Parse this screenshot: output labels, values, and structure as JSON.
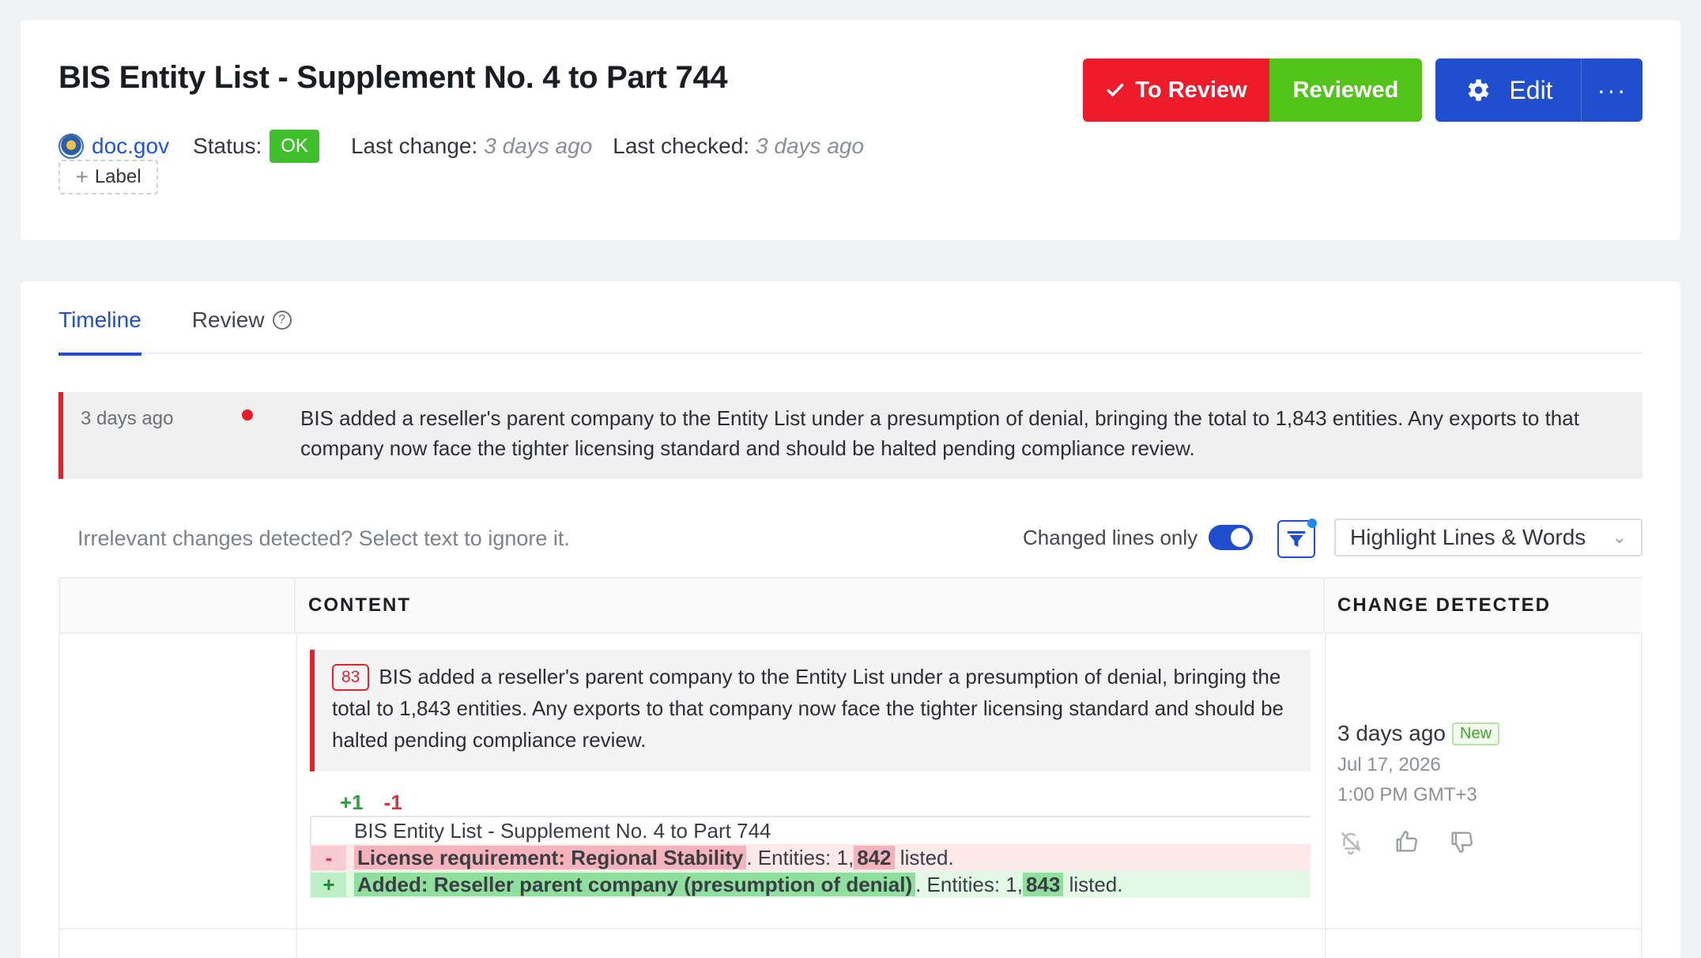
{
  "header": {
    "title": "BIS Entity List - Supplement No. 4 to Part 744",
    "site": "doc.gov",
    "status_label": "Status:",
    "status_value": "OK",
    "last_change_label": "Last change:",
    "last_change_value": "3 days ago",
    "last_checked_label": "Last checked:",
    "last_checked_value": "3 days ago",
    "add_label": "Label",
    "to_review_label": "To Review",
    "reviewed_label": "Reviewed",
    "edit_label": "Edit",
    "more_label": "···"
  },
  "tabs": [
    {
      "label": "Timeline",
      "active": true
    },
    {
      "label": "Review",
      "active": false
    }
  ],
  "timeline": {
    "time": "3 days ago",
    "text": "BIS added a reseller's parent company to the Entity List under a presumption of denial, bringing the total to 1,843 entities. Any exports to that company now face the tighter licensing standard and should be halted pending compliance review."
  },
  "toolbar": {
    "hint": "Irrelevant changes detected? Select text to ignore it.",
    "changed_lines_label": "Changed lines only",
    "changed_lines_on": true,
    "highlight_mode": "Highlight Lines & Words"
  },
  "table": {
    "headers": [
      "",
      "CONTENT",
      "CHANGE DETECTED"
    ],
    "row": {
      "line_number": "83",
      "summary": "BIS added a reseller's parent company to the Entity List under a presumption of denial, bringing the total to 1,843 entities. Any exports to that company now face the tighter licensing standard and should be halted pending compliance review.",
      "added_count": "+1",
      "removed_count": "-1",
      "context_line": "BIS Entity List - Supplement No. 4 to Part 744",
      "removed_marker": "-",
      "removed_hl": "License requirement: Regional Stability",
      "removed_mid": ". Entities: 1,",
      "removed_num": "842",
      "removed_tail": " listed.",
      "added_marker": "+",
      "added_hl": "Added: Reseller parent company (presumption of denial)",
      "added_mid": ". Entities: 1,",
      "added_num": "843",
      "added_tail": " listed.",
      "change_ago": "3 days ago",
      "new_badge": "New",
      "change_date": "Jul 17, 2026",
      "change_time": "1:00 PM GMT+3"
    }
  },
  "colors": {
    "accent": "#1f4fcf",
    "to_review": "#ee1c2b",
    "reviewed": "#52c41a",
    "status_ok": "#3fbf2b"
  },
  "icons": [
    "seal-icon",
    "plus-icon",
    "check-icon",
    "gear-icon",
    "help-icon",
    "filter-icon",
    "chevron-down-icon",
    "mute-bell-icon",
    "thumbs-up-icon",
    "thumbs-down-icon"
  ]
}
